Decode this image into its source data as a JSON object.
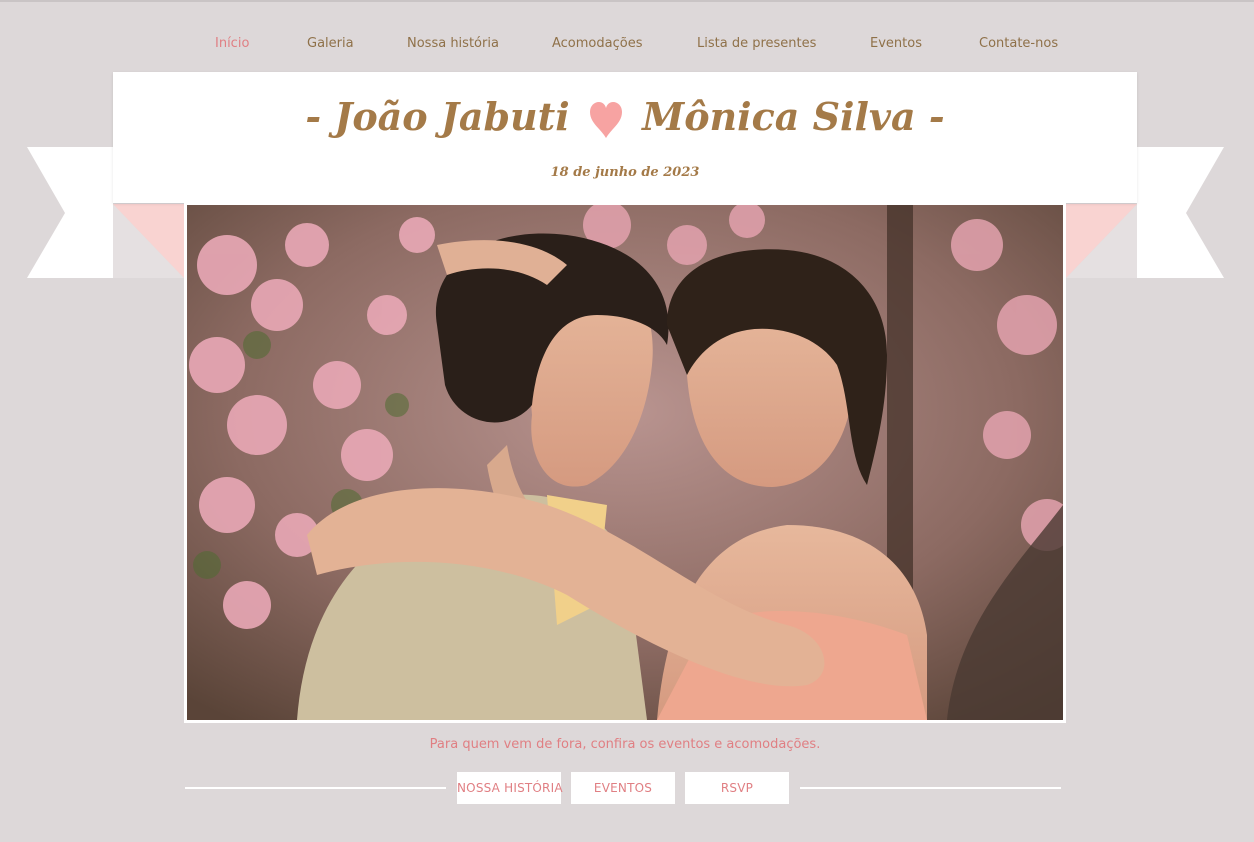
{
  "nav": {
    "items": [
      {
        "label": "Início",
        "active": true
      },
      {
        "label": "Galeria"
      },
      {
        "label": "Nossa história"
      },
      {
        "label": "Acomodações"
      },
      {
        "label": "Lista de presentes"
      },
      {
        "label": "Eventos"
      },
      {
        "label": "Contate-nos"
      }
    ]
  },
  "header": {
    "name_left": "- João Jabuti",
    "name_right": "Mônica Silva -",
    "date": "18 de junho de 2023"
  },
  "tagline": "Para quem vem de fora, confira os eventos e acomodações.",
  "buttons": {
    "story": "Nossa história",
    "events": "Eventos",
    "rsvp": "RSVP"
  },
  "colors": {
    "accent": "#e07f83",
    "brown": "#a47a48",
    "nav_text": "#8f7149",
    "background": "#ddd8d9",
    "ribbon_pink": "#f9d3d1"
  },
  "icons": {
    "heart": "heart-icon"
  }
}
